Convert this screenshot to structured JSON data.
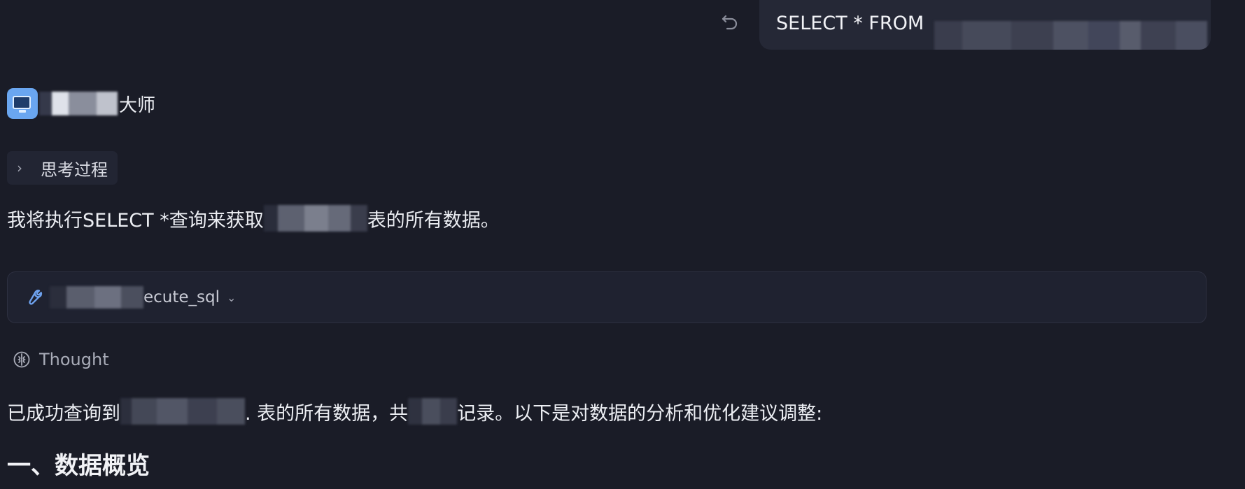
{
  "user_message": {
    "text": "SELECT * FROM"
  },
  "assistant": {
    "name_visible_suffix": "大师"
  },
  "thinking_toggle": {
    "label": "思考过程"
  },
  "message": {
    "intro_prefix": "我将执行SELECT *查询来获取",
    "intro_suffix": "表的所有数据。",
    "result_prefix": "已成功查询到",
    "result_middle": ". 表的所有数据，共",
    "result_suffix": "记录。以下是对数据的分析和优化建议调整:"
  },
  "tool_call": {
    "name_visible_suffix": "ecute_sql"
  },
  "thought": {
    "label": "Thought"
  },
  "section": {
    "heading": "一、数据概览"
  },
  "colors": {
    "background": "#1a1c27",
    "bubble": "#252836",
    "accent": "#6ea2ef"
  }
}
